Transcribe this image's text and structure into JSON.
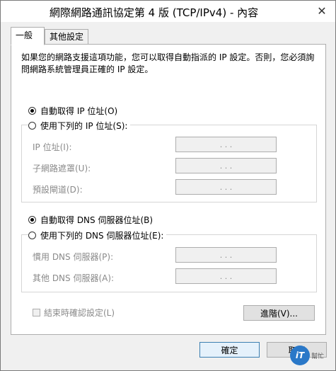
{
  "window": {
    "title": "網際網路通訊協定第 4 版 (TCP/IPv4) - 內容",
    "close_glyph": "✕"
  },
  "tabs": [
    {
      "label": "一般"
    },
    {
      "label": "其他設定"
    }
  ],
  "description": "如果您的網路支援這項功能，您可以取得自動指派的 IP 設定。否則，您必須詢問網路系統管理員正確的 IP 設定。",
  "ip": {
    "auto_label": "自動取得 IP 位址(O)",
    "manual_label": "使用下列的 IP 位址(S):",
    "fields": [
      {
        "label": "IP 位址(I):",
        "value": ".   .   ."
      },
      {
        "label": "子網路遮罩(U):",
        "value": ".   .   ."
      },
      {
        "label": "預設閘道(D):",
        "value": ".   .   ."
      }
    ]
  },
  "dns": {
    "auto_label": "自動取得 DNS 伺服器位址(B)",
    "manual_label": "使用下列的 DNS 伺服器位址(E):",
    "fields": [
      {
        "label": "慣用 DNS 伺服器(P):",
        "value": ".   .   ."
      },
      {
        "label": "其他 DNS 伺服器(A):",
        "value": ".   .   ."
      }
    ]
  },
  "validate_label": "結束時確認設定(L)",
  "advanced_label": "進階(V)...",
  "ok_label": "確定",
  "cancel_label": "取消",
  "watermark": {
    "logo": "iT",
    "text": "幫忙"
  }
}
